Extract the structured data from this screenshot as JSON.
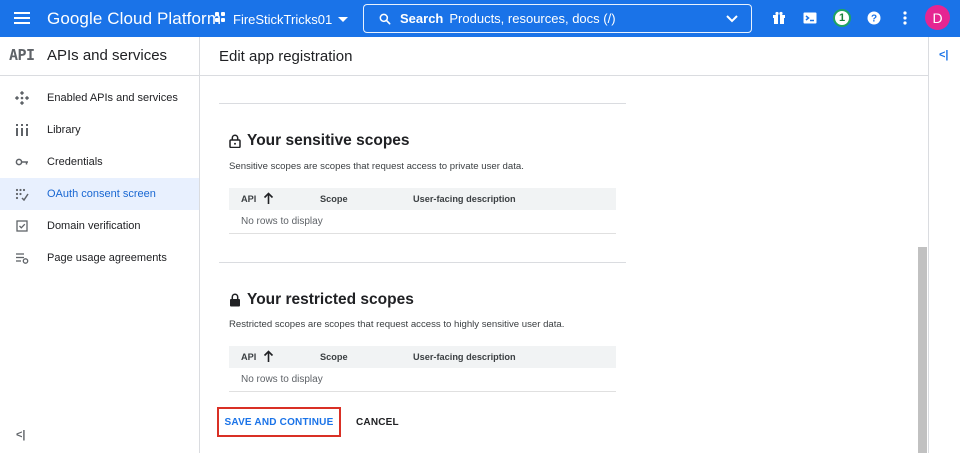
{
  "topbar": {
    "brand": "Google Cloud Platform",
    "project_name": "FireStickTricks01",
    "search_label": "Search",
    "search_placeholder": "Products, resources, docs (/)",
    "notification_count": "1",
    "avatar_letter": "D",
    "icons": [
      "menu-icon",
      "project-dots-icon",
      "caret-down-icon",
      "search-icon",
      "chevron-down-icon",
      "gift-icon",
      "terminal-icon",
      "notifications-badge",
      "help-icon",
      "more-vert-icon"
    ]
  },
  "sidebar": {
    "logo": "API",
    "title": "APIs and services",
    "items": [
      {
        "label": "Enabled APIs and services",
        "icon": "enabled-apis-icon"
      },
      {
        "label": "Library",
        "icon": "library-icon"
      },
      {
        "label": "Credentials",
        "icon": "key-icon"
      },
      {
        "label": "OAuth consent screen",
        "icon": "oauth-icon",
        "active": true
      },
      {
        "label": "Domain verification",
        "icon": "checkbox-icon"
      },
      {
        "label": "Page usage agreements",
        "icon": "settings-list-icon"
      }
    ],
    "collapse_label": "<|"
  },
  "main": {
    "title": "Edit app registration",
    "rail_label": "<|",
    "sensitive": {
      "title": "Your sensitive scopes",
      "description": "Sensitive scopes are scopes that request access to private user data.",
      "columns": [
        "API",
        "Scope",
        "User-facing description"
      ],
      "empty": "No rows to display"
    },
    "restricted": {
      "title": "Your restricted scopes",
      "description": "Restricted scopes are scopes that request access to highly sensitive user data.",
      "columns": [
        "API",
        "Scope",
        "User-facing description"
      ],
      "empty": "No rows to display"
    },
    "save_label": "SAVE AND CONTINUE",
    "cancel_label": "CANCEL"
  },
  "colors": {
    "topbar": "#1a73e8",
    "active_item_bg": "#e8f0fe",
    "active_item_text": "#1967d2",
    "highlight_border": "#d93025",
    "avatar": "#e52592"
  }
}
